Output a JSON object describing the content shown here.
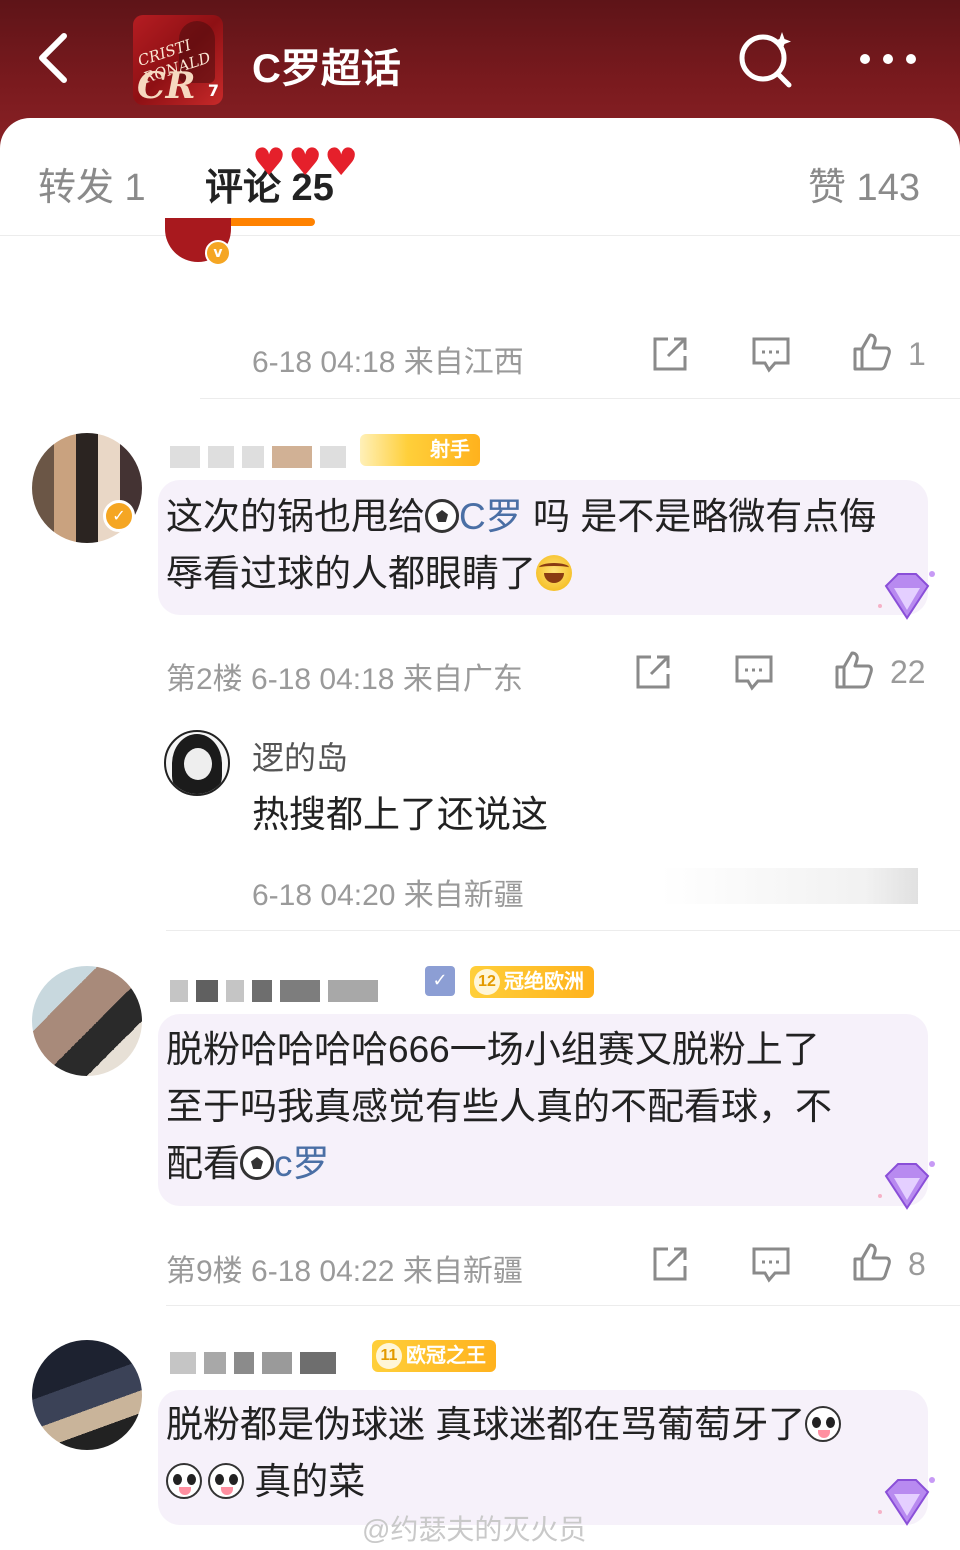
{
  "header": {
    "title": "C罗超话",
    "thumb_text_1": "CRISTI RONALD",
    "thumb_text_2": "CR",
    "thumb_text_3": "7",
    "back_icon": "chevron-left-icon",
    "search_icon": "search-icon",
    "more_icon": "more-dots-icon",
    "colors": {
      "header_bg": "#6d181c",
      "tab_accent": "#ff8200"
    }
  },
  "tabs": {
    "repost": "转发 1",
    "comments": "评论 25",
    "likes": "赞 143"
  },
  "comment_top": {
    "hearts": "♥♥♥",
    "meta": "6-18 04:18 来自江西",
    "like_count": "1"
  },
  "comment_floor2": {
    "badge_text": "射手",
    "body_pre": "这次的锅也甩给",
    "mention": "C罗",
    "body_post": " 吗 是不是略微有点侮辱看过球的人都眼睛了",
    "floor": "第2楼",
    "meta": "6-18 04:18 来自广东",
    "like_count": "22",
    "reply": {
      "name": "逻的岛",
      "text": "热搜都上了还说这",
      "meta": "6-18 04:20 来自新疆"
    }
  },
  "comment_floor9": {
    "badge_level": "12",
    "badge_text": "冠绝欧洲",
    "body_line1": "脱粉哈哈哈哈666一场小组赛又脱粉上了",
    "body_line2": "至于吗我真感觉有些人真的不配看球，不",
    "body_line3_pre": "配看",
    "mention": "c罗",
    "floor": "第9楼",
    "meta": "6-18 04:22 来自新疆",
    "like_count": "8"
  },
  "comment_last": {
    "badge_level": "11",
    "badge_text": "欧冠之王",
    "body_line1": "脱粉都是伪球迷 真球迷都在骂葡萄牙了",
    "body_line2": " 真的菜"
  },
  "watermark": "@约瑟夫的灭火员"
}
